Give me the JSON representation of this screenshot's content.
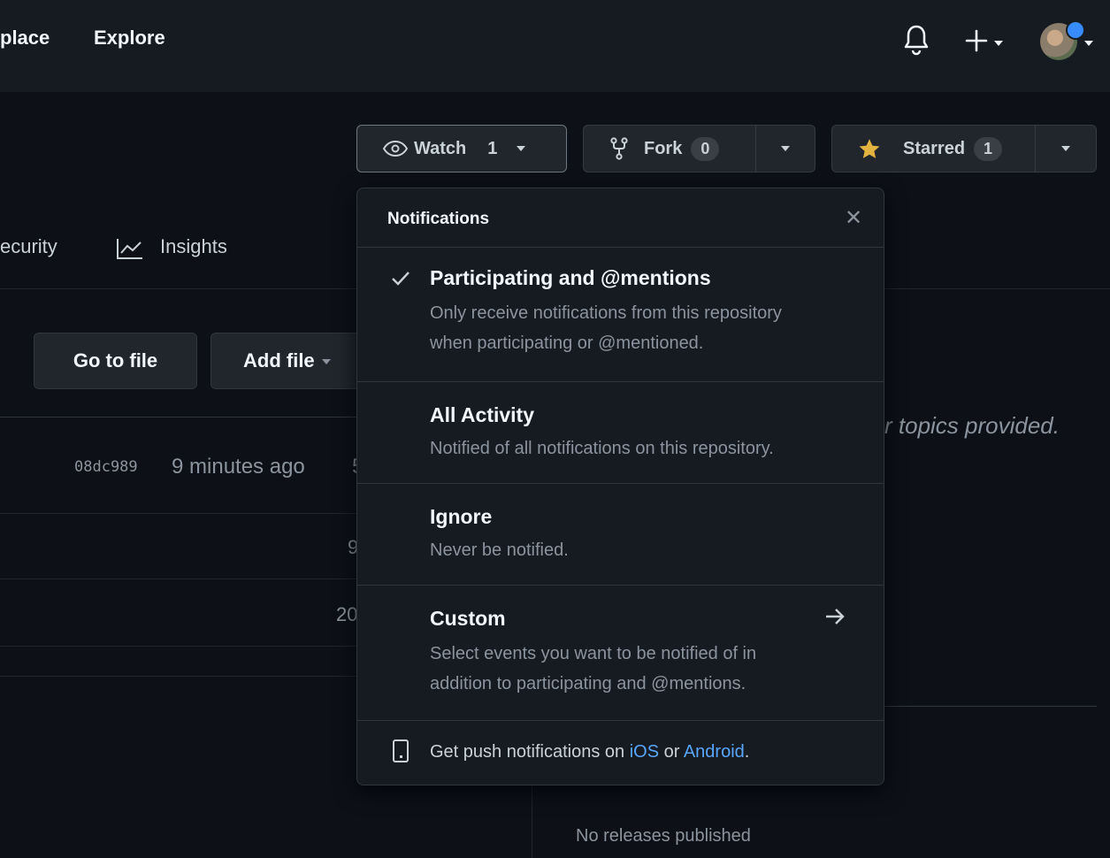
{
  "header": {
    "nav": [
      "place",
      "Explore"
    ],
    "bell_icon": "bell-icon",
    "plus_icon": "plus-icon"
  },
  "repo_actions": {
    "watch": {
      "label": "Watch",
      "count": "1"
    },
    "fork": {
      "label": "Fork",
      "count": "0"
    },
    "star": {
      "label": "Starred",
      "count": "1"
    }
  },
  "tabs": {
    "security": "ecurity",
    "insights": "Insights"
  },
  "file_buttons": {
    "go_to_file": "Go to file",
    "add_file": "Add file"
  },
  "commit": {
    "sha": "08dc989",
    "time": "9 minutes ago",
    "partial": "5"
  },
  "rows": [
    "9",
    "20"
  ],
  "about": {
    "topics_text": "r topics provided.",
    "releases": "No releases published"
  },
  "notifications_menu": {
    "title": "Notifications",
    "options": [
      {
        "label": "Participating and @mentions",
        "description_lines": [
          "Only receive notifications from this repository",
          "when participating or @mentioned."
        ],
        "selected": true
      },
      {
        "label": "All Activity",
        "description_lines": [
          "Notified of all notifications on this repository."
        ],
        "selected": false
      },
      {
        "label": "Ignore",
        "description_lines": [
          "Never be notified."
        ],
        "selected": false
      },
      {
        "label": "Custom",
        "description_lines": [
          "Select events you want to be notified of in",
          "addition to participating and @mentions."
        ],
        "selected": false
      }
    ],
    "footer": {
      "prefix": "Get push notifications on ",
      "ios": "iOS",
      "middle": " or ",
      "android": "Android",
      "suffix": "."
    }
  },
  "colors": {
    "accent": "#58a6ff",
    "star": "#e3b341",
    "background": "#0d1117"
  }
}
